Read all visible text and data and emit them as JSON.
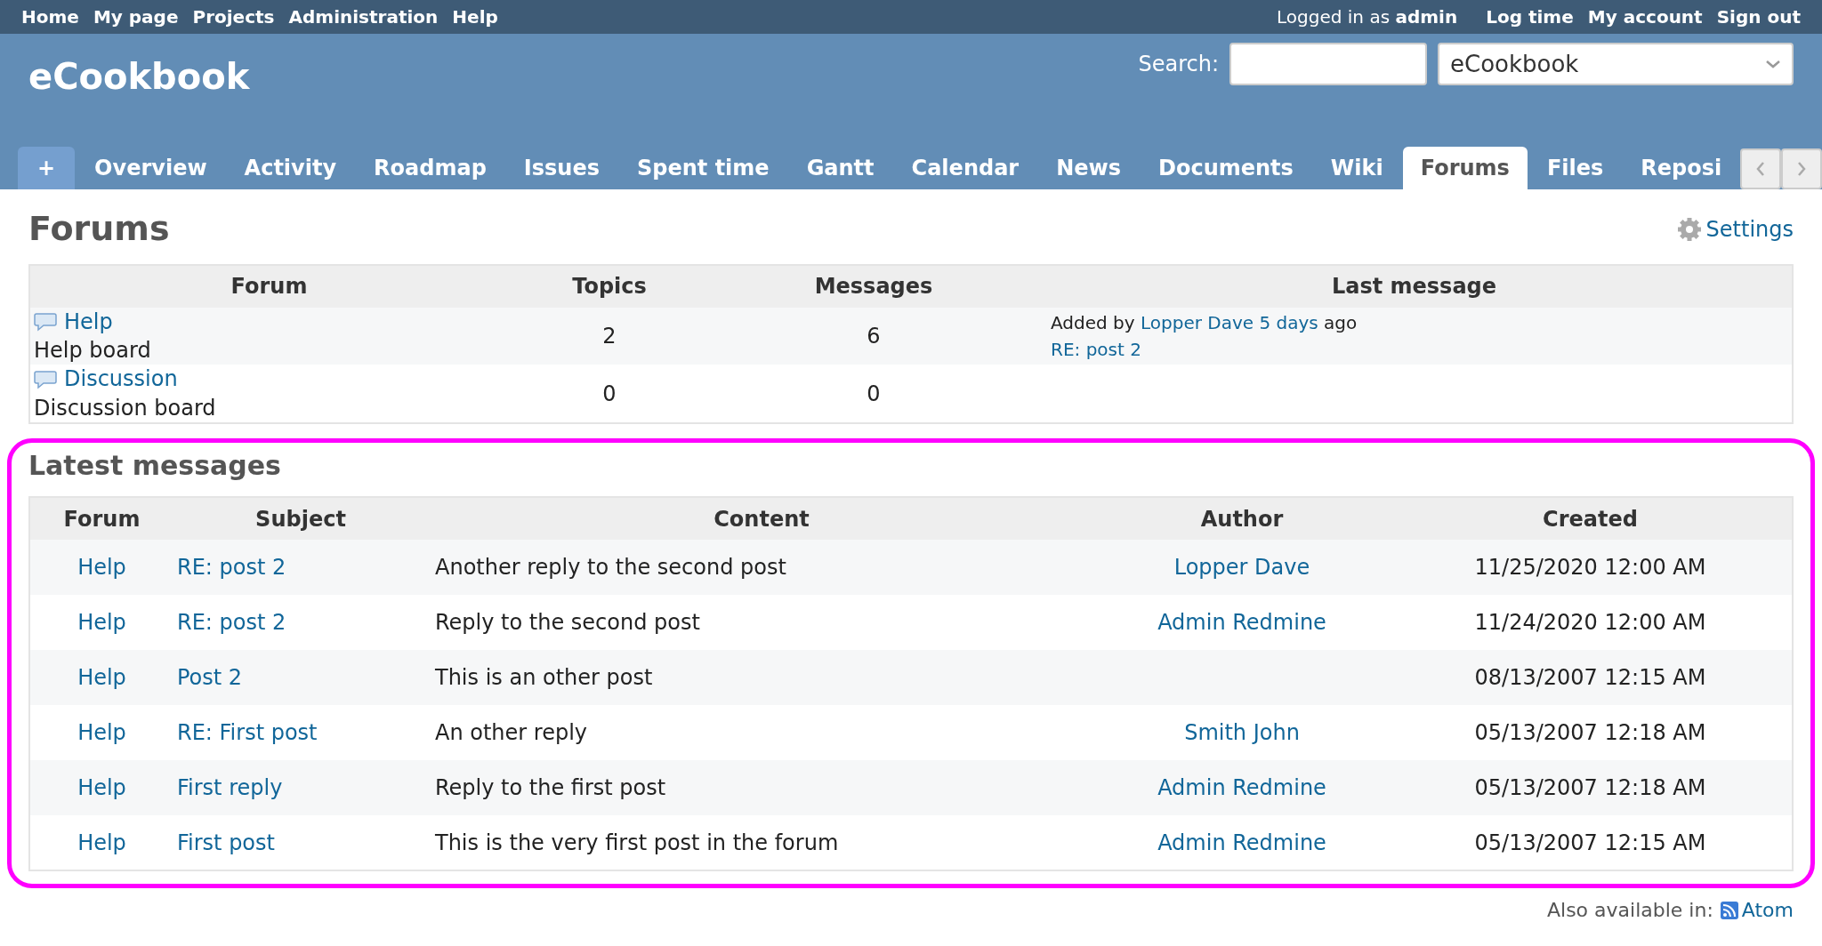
{
  "top_menu": {
    "left": [
      "Home",
      "My page",
      "Projects",
      "Administration",
      "Help"
    ],
    "logged_in": "Logged in as **admin**",
    "right": [
      "Log time",
      "My account",
      "Sign out"
    ]
  },
  "header": {
    "title": "eCookbook",
    "search_label": "Search:",
    "project_select": "eCookbook"
  },
  "tabs": [
    {
      "label": "+",
      "kind": "new",
      "selected": false
    },
    {
      "label": "Overview",
      "kind": "tab",
      "selected": false
    },
    {
      "label": "Activity",
      "kind": "tab",
      "selected": false
    },
    {
      "label": "Roadmap",
      "kind": "tab",
      "selected": false
    },
    {
      "label": "Issues",
      "kind": "tab",
      "selected": false
    },
    {
      "label": "Spent time",
      "kind": "tab",
      "selected": false
    },
    {
      "label": "Gantt",
      "kind": "tab",
      "selected": false
    },
    {
      "label": "Calendar",
      "kind": "tab",
      "selected": false
    },
    {
      "label": "News",
      "kind": "tab",
      "selected": false
    },
    {
      "label": "Documents",
      "kind": "tab",
      "selected": false
    },
    {
      "label": "Wiki",
      "kind": "tab",
      "selected": false
    },
    {
      "label": "Forums",
      "kind": "tab",
      "selected": true
    },
    {
      "label": "Files",
      "kind": "tab",
      "selected": false
    },
    {
      "label": "Reposi",
      "kind": "tab",
      "selected": false
    }
  ],
  "page": {
    "title": "Forums",
    "settings": "Settings"
  },
  "forums": {
    "columns": [
      "Forum",
      "Topics",
      "Messages",
      "Last message"
    ],
    "rows": [
      {
        "name": "Help",
        "description": "Help board",
        "topics": "2",
        "messages": "6",
        "last_message": {
          "prefix": "Added by",
          "author": "Lopper Dave",
          "time": "5 days",
          "suffix": "ago",
          "subject": "RE: post 2"
        }
      },
      {
        "name": "Discussion",
        "description": "Discussion board",
        "topics": "0",
        "messages": "0"
      }
    ]
  },
  "latest": {
    "title": "Latest messages",
    "highlighted": true,
    "columns": [
      "Forum",
      "Subject",
      "Content",
      "Author",
      "Created"
    ],
    "rows": [
      {
        "forum": "Help",
        "subject": "RE: post 2",
        "content": "Another reply to the second post",
        "author": "Lopper Dave",
        "created": "11/25/2020 12:00 AM"
      },
      {
        "forum": "Help",
        "subject": "RE: post 2",
        "content": "Reply to the second post",
        "author": "Admin Redmine",
        "created": "11/24/2020 12:00 AM"
      },
      {
        "forum": "Help",
        "subject": "Post 2",
        "content": "This is an other post",
        "created": "08/13/2007 12:15 AM"
      },
      {
        "forum": "Help",
        "subject": "RE: First post",
        "content": "An other reply",
        "author": "Smith John",
        "created": "05/13/2007 12:18 AM"
      },
      {
        "forum": "Help",
        "subject": "First reply",
        "content": "Reply to the first post",
        "author": "Admin Redmine",
        "created": "05/13/2007 12:18 AM"
      },
      {
        "forum": "Help",
        "subject": "First post",
        "content": "This is the very first post in the forum",
        "author": "Admin Redmine",
        "created": "05/13/2007 12:15 AM"
      }
    ]
  },
  "footer": {
    "label": "Also available in:",
    "link": "Atom"
  }
}
